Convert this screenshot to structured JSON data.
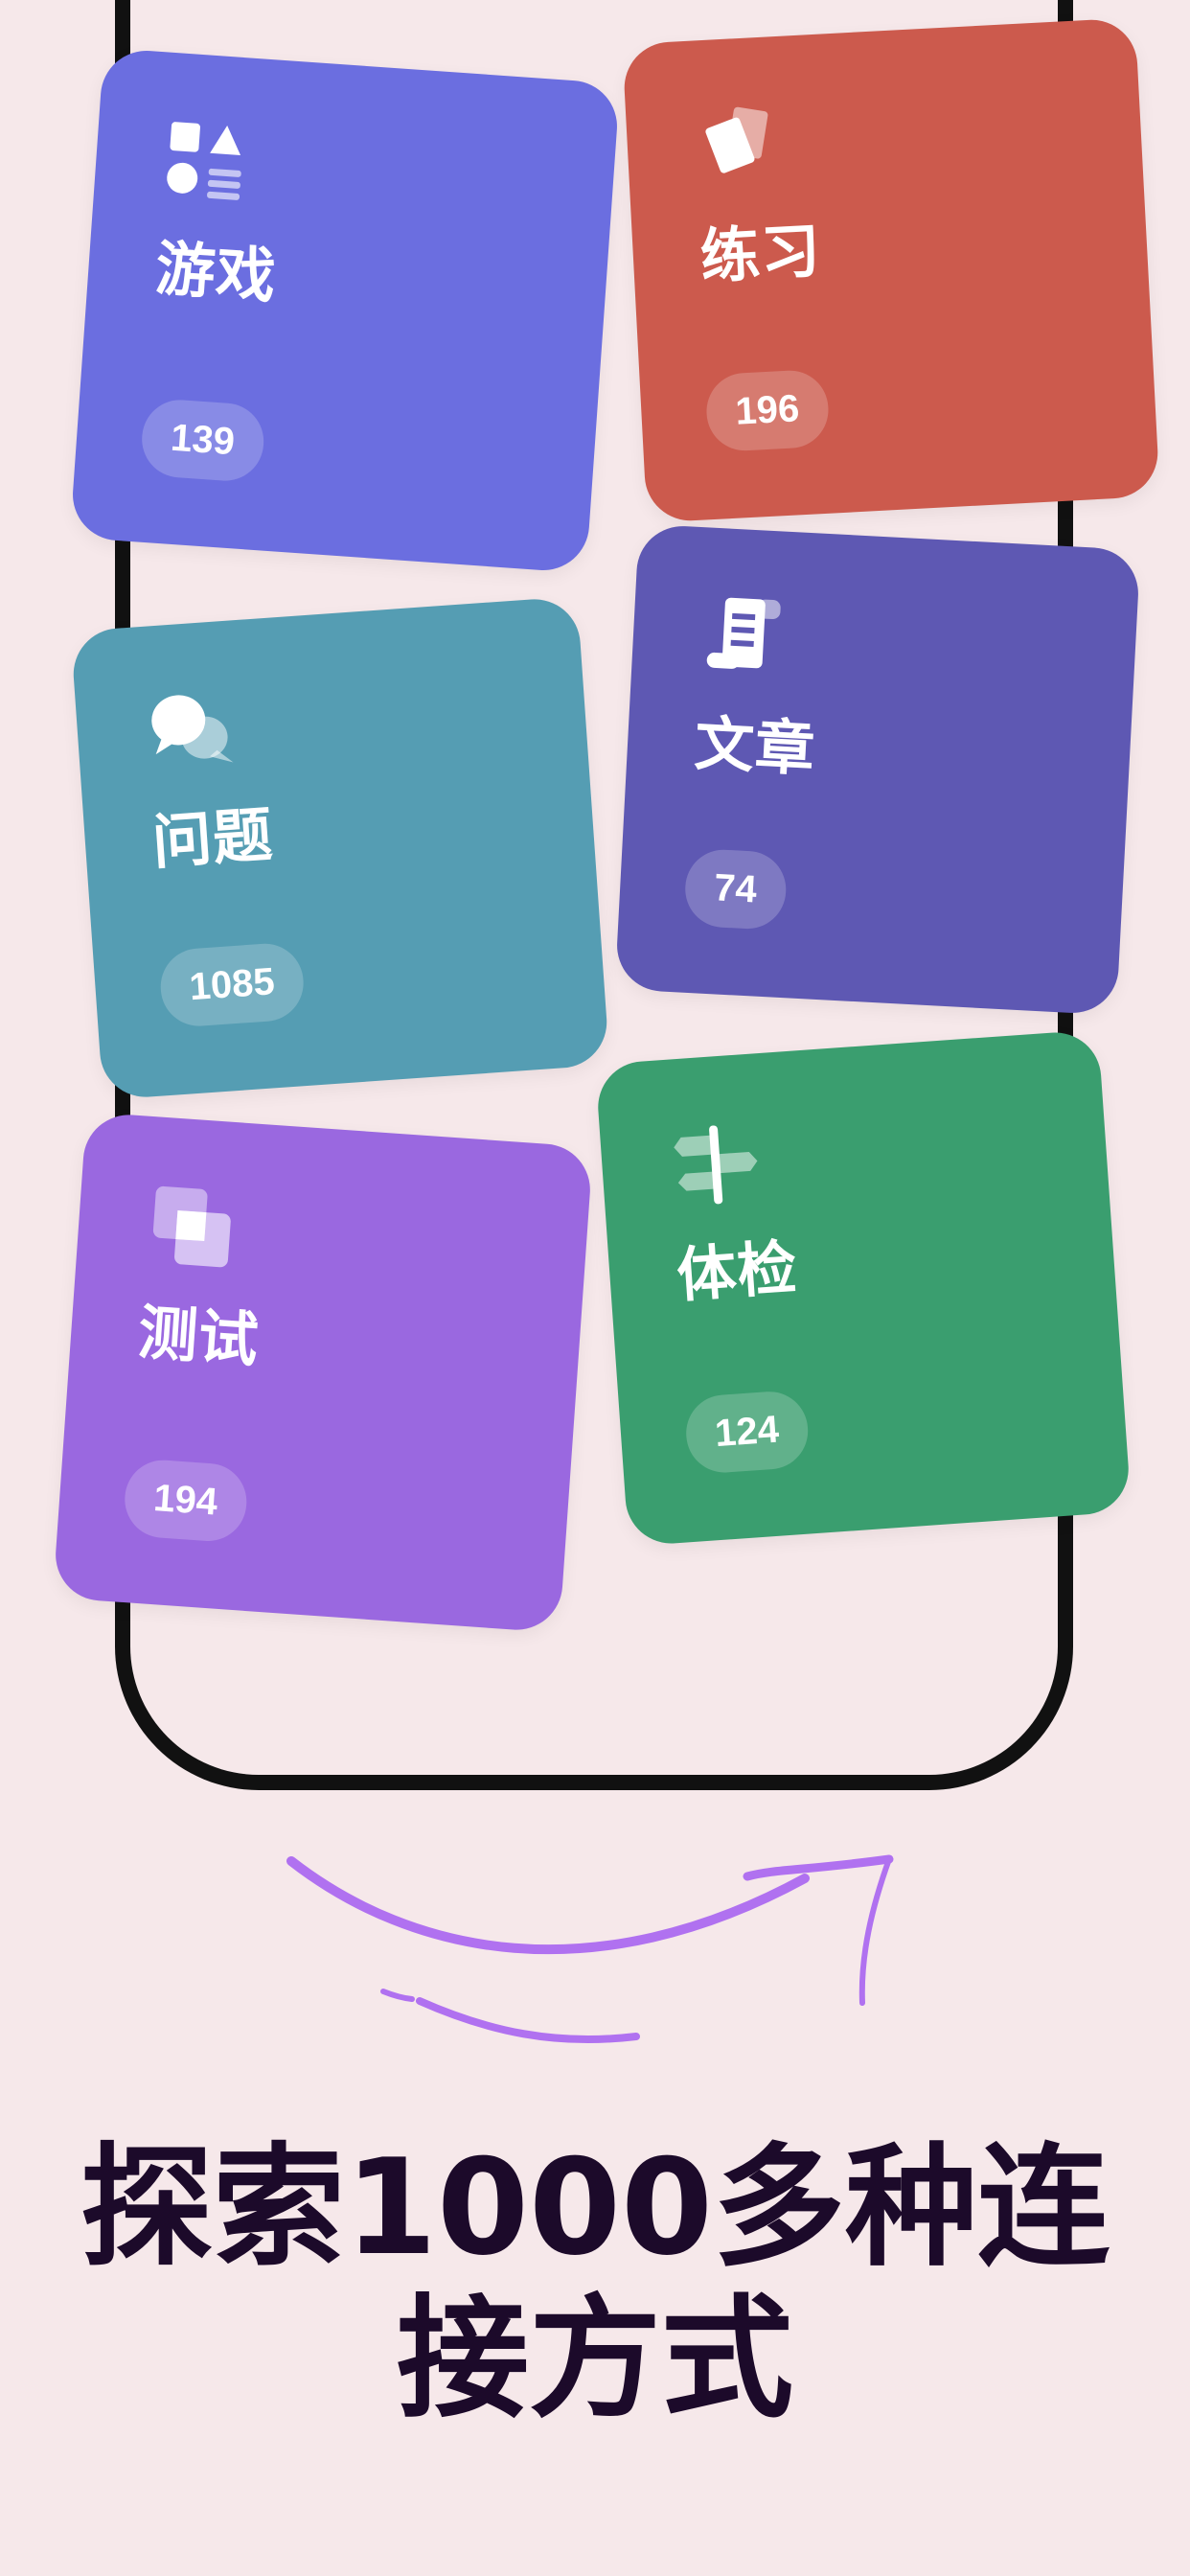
{
  "categories": [
    {
      "title": "游戏",
      "count": "139",
      "color": "#6b6ee0",
      "icon": "shapes-icon"
    },
    {
      "title": "练习",
      "count": "196",
      "color": "#cc5a4d",
      "icon": "cards-icon"
    },
    {
      "title": "问题",
      "count": "1085",
      "color": "#559db3",
      "icon": "chat-bubbles-icon"
    },
    {
      "title": "文章",
      "count": "74",
      "color": "#5e58b3",
      "icon": "scroll-icon"
    },
    {
      "title": "测试",
      "count": "194",
      "color": "#9a68e0",
      "icon": "squares-icon"
    },
    {
      "title": "体检",
      "count": "124",
      "color": "#3a9e6f",
      "icon": "signpost-icon"
    }
  ],
  "headline": {
    "line1": "探索1000多种连",
    "line2": "接方式"
  },
  "colors": {
    "background": "#f6e8ea",
    "arrow": "#b071f0",
    "headline": "#1c0a2a"
  }
}
